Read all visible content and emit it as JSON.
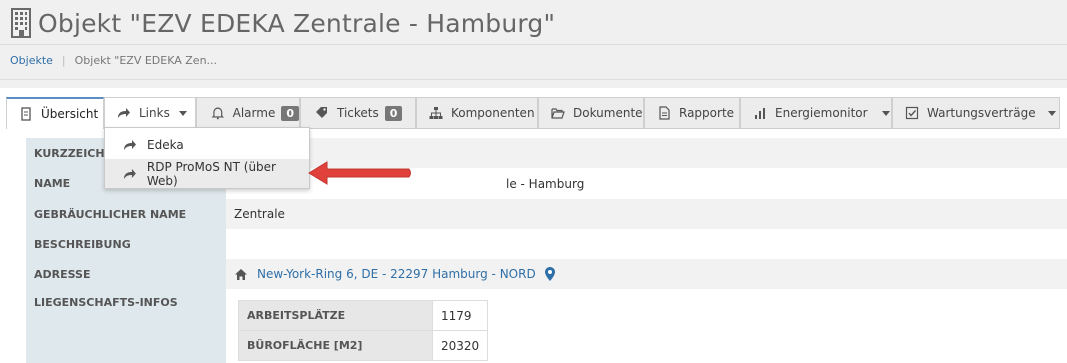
{
  "page": {
    "title": "Objekt \"EZV EDEKA Zentrale - Hamburg\"",
    "breadcrumb": [
      {
        "label": "Objekte"
      },
      {
        "label": "Objekt \"EZV EDEKA Zen..."
      }
    ]
  },
  "tabs": [
    {
      "label": "Übersicht",
      "icon": "document-icon"
    },
    {
      "label": "Links",
      "icon": "share-arrow-icon"
    },
    {
      "label": "Alarme",
      "icon": "bell-icon",
      "badge": "0"
    },
    {
      "label": "Tickets",
      "icon": "tag-icon",
      "badge": "0"
    },
    {
      "label": "Komponenten",
      "icon": "sitemap-icon"
    },
    {
      "label": "Dokumente",
      "icon": "folder-open-icon"
    },
    {
      "label": "Rapporte",
      "icon": "file-text-icon"
    },
    {
      "label": "Energiemonitor",
      "icon": "bar-chart-icon"
    },
    {
      "label": "Wartungsverträge",
      "icon": "check-square-icon"
    }
  ],
  "links_menu": {
    "items": [
      {
        "label": "Edeka",
        "icon": "share-arrow-icon"
      },
      {
        "label": "RDP ProMoS NT (über Web)",
        "icon": "share-arrow-icon"
      }
    ]
  },
  "details": {
    "rows": [
      {
        "label": "KURZZEICHEN",
        "value": ""
      },
      {
        "label": "NAME",
        "value": "le - Hamburg"
      },
      {
        "label": "GEBRÄUCHLICHER NAME",
        "value": "Zentrale"
      },
      {
        "label": "BESCHREIBUNG",
        "value": ""
      },
      {
        "label": "ADRESSE",
        "value": "New-York-Ring 6, DE - 22297 Hamburg - NORD"
      },
      {
        "label": "LIEGENSCHAFTS-INFOS",
        "value": ""
      }
    ],
    "liegenschaft": [
      {
        "label": "ARBEITSPLÄTZE",
        "value": "1179"
      },
      {
        "label": "BÜROFLÄCHE [M2]",
        "value": "20320"
      }
    ]
  },
  "colors": {
    "accent": "#5a8fc4",
    "link": "#2f6fa7",
    "label_bg": "#dfe8ec",
    "arrow": "#e0413a",
    "badge": "#777777"
  }
}
